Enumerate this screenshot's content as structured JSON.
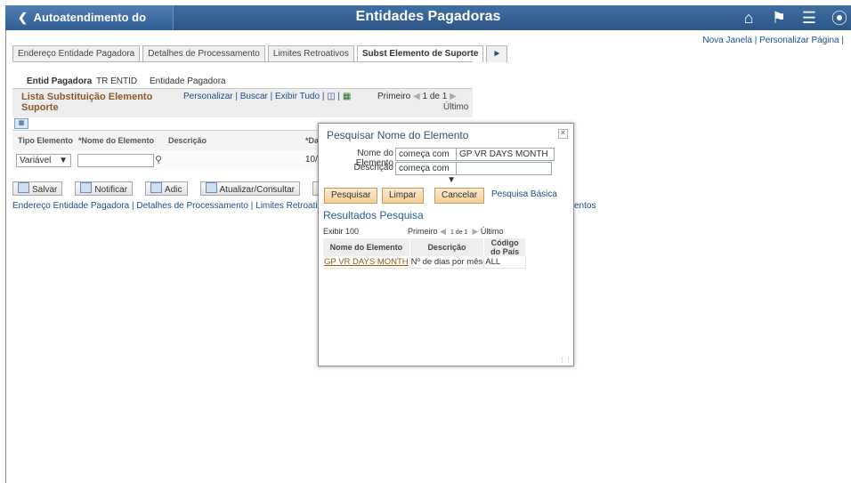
{
  "banner": {
    "back_label": "Autoatendimento do Gerente",
    "title": "Entidades Pagadoras"
  },
  "toplinks": {
    "new_window": "Nova Janela",
    "personalize": "Personalizar Página"
  },
  "tabs": [
    {
      "label": "Endereço Entidade Pagadora"
    },
    {
      "label": "Detalhes de Processamento"
    },
    {
      "label": "Limites Retroativos"
    },
    {
      "label": "Subst Elemento de Suporte"
    }
  ],
  "entity": {
    "label": "Entid Pagadora",
    "code": "TR ENTID",
    "desc": "Entidade Pagadora"
  },
  "grid": {
    "title": "Lista Substituição Elemento Suporte",
    "nav": "Personalizar | Buscar | Exibir Tudo |",
    "first": "Primeiro",
    "range": "1 de 1",
    "last": "Último",
    "columns": {
      "tipo": "Tipo Elemento",
      "nome": "*Nome do Elemento",
      "descricao": "Descrição",
      "data": "*Da"
    },
    "row": {
      "tipo": "Variável",
      "data": "10/"
    }
  },
  "actions": {
    "save": "Salvar",
    "notify": "Notificar",
    "add": "Adic",
    "refresh": "Atualizar/Consultar",
    "more": "In"
  },
  "footlinks": {
    "text": "Endereço Entidade Pagadora | Detalhes de Processamento | Limites Retroativos | Sub",
    "end": "entos"
  },
  "modal": {
    "title": "Pesquisar Nome do Elemento",
    "field1_label": "Nome do Elemento",
    "field1_op": "começa com",
    "field1_value": "GP VR DAYS MONTH",
    "field2_label": "Descrição",
    "field2_op": "começa com",
    "btn_search": "Pesquisar",
    "btn_clear": "Limpar",
    "btn_cancel": "Cancelar",
    "basic_link": "Pesquisa Básica",
    "results_title": "Resultados Pesquisa",
    "show": "Exibir 100",
    "first": "Primeiro",
    "range": "1 de 1",
    "last": "Último",
    "columns": [
      "Nome do Elemento",
      "Descrição",
      "Código do País"
    ],
    "rows": [
      {
        "nome": "GP VR DAYS MONTH",
        "descricao": "Nº de dias por mês",
        "pais": "ALL"
      }
    ]
  }
}
